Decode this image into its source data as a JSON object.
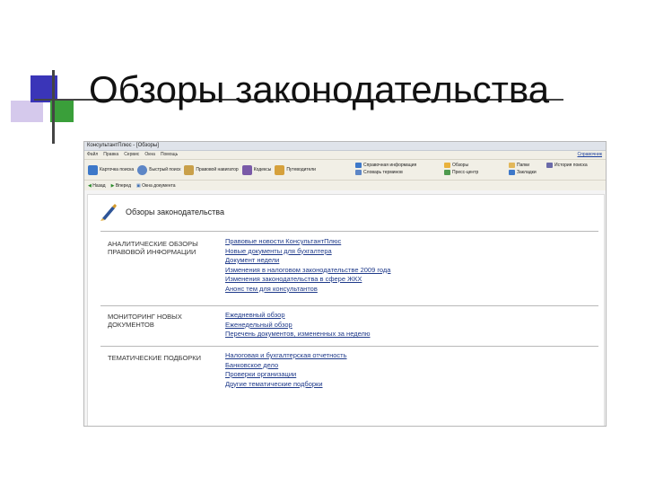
{
  "slide": {
    "title": "Обзоры законодательства"
  },
  "window": {
    "title": "КонсультантПлюс - [Обзоры]",
    "menu": [
      "Файл",
      "Правка",
      "Сервис",
      "Окна",
      "Помощь"
    ],
    "help_link": "Справочник"
  },
  "toolbar": {
    "buttons": [
      {
        "label": "Карточка поиска",
        "icon": "search-card-icon",
        "color": "#3d78c9"
      },
      {
        "label": "Быстрый поиск",
        "icon": "magnifier-icon",
        "color": "#5d86c6"
      },
      {
        "label": "Правовой навигатор",
        "icon": "navigator-icon",
        "color": "#c9a04a"
      },
      {
        "label": "Кодексы",
        "icon": "codes-icon",
        "color": "#7a5aa8"
      },
      {
        "label": "Путеводители",
        "icon": "guides-icon",
        "color": "#d6a13c"
      }
    ],
    "right_groups": [
      {
        "items": [
          {
            "label": "Справочная информация",
            "color": "#3d78c9"
          },
          {
            "label": "Словарь терминов",
            "color": "#5d86c6"
          }
        ]
      },
      {
        "items": [
          {
            "label": "Обзоры",
            "color": "#e9b23c"
          },
          {
            "label": "Пресс-центр",
            "color": "#4e9a4e"
          }
        ]
      },
      {
        "items": [
          {
            "label": "Папки",
            "color": "#e2b75a"
          },
          {
            "label": "Закладки",
            "color": "#3d78c9"
          }
        ]
      },
      {
        "items": [
          {
            "label": "История поиска",
            "color": "#6a6aa8"
          }
        ]
      }
    ]
  },
  "navbar": {
    "back": "Назад",
    "forward": "Вперед",
    "doc_tabs": "Окна документа"
  },
  "page": {
    "title": "Обзоры законодательства",
    "sections": [
      {
        "label": "Аналитические обзоры правовой информации",
        "links": [
          "Правовые новости КонсультантПлюс",
          "Новые документы для бухгалтера",
          "Документ недели",
          "Изменения в налоговом законодательстве 2009 года",
          "Изменения законодательства в сфере ЖКХ",
          "Анонс тем для консультантов"
        ]
      },
      {
        "label": "Мониторинг новых документов",
        "links": [
          "Ежедневный обзор",
          "Еженедельный обзор",
          "Перечень документов, измененных за неделю"
        ]
      },
      {
        "label": "Тематические подборки",
        "links": [
          "Налоговая и бухгалтерская отчетность",
          "Банковское дело",
          "Проверки организации",
          "Другие тематические подборки"
        ]
      }
    ]
  },
  "colors": {
    "decor_blue": "#3a35b8",
    "decor_purple": "#d5c9ec",
    "decor_green": "#3a9f3a",
    "link": "#1f3a8a"
  }
}
